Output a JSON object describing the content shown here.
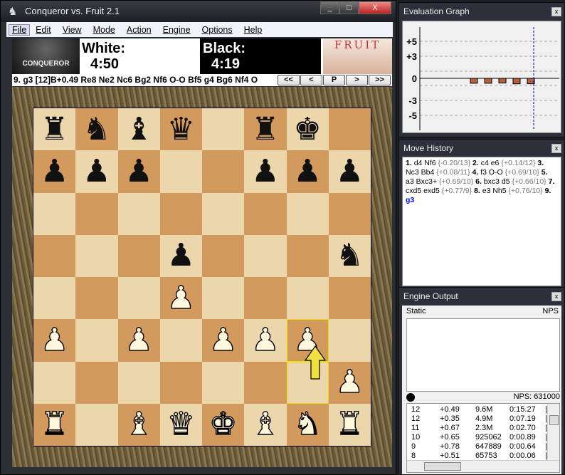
{
  "window": {
    "title": "Conqueror vs. Fruit 2.1",
    "min": "_",
    "max": "□",
    "close": "X"
  },
  "menu": [
    "File",
    "Edit",
    "View",
    "Mode",
    "Action",
    "Engine",
    "Options",
    "Help"
  ],
  "header": {
    "white_logo": "CONQUEROR",
    "white_label": "White:",
    "white_time": "4:50",
    "black_label": "Black:",
    "black_time": "4:19",
    "black_logo": "FRUIT"
  },
  "moveline": {
    "text": "9. g3  [12]B+0.49 Re8 Ne2 Nc6 Bg2 Nf6 O-O Bf5 g4 Bg6 Nf4 O",
    "buttons": [
      "<<",
      "<",
      "P",
      ">",
      ">>"
    ]
  },
  "board": {
    "rows": [
      [
        "br",
        "bn",
        "bb",
        "bq",
        "",
        "br",
        "bk",
        ""
      ],
      [
        "bp",
        "bp",
        "bp",
        "",
        "",
        "bp",
        "bp",
        "bp"
      ],
      [
        "",
        "",
        "",
        "",
        "",
        "",
        "",
        ""
      ],
      [
        "",
        "",
        "",
        "bp",
        "",
        "",
        "",
        "bn"
      ],
      [
        "",
        "",
        "",
        "wp",
        "",
        "",
        "",
        ""
      ],
      [
        "wp",
        "",
        "wp",
        "",
        "wp",
        "wp",
        "wp",
        ""
      ],
      [
        "",
        "",
        "",
        "",
        "",
        "",
        "",
        "wp"
      ],
      [
        "wr",
        "",
        "wb",
        "wq",
        "wk",
        "wb",
        "wn",
        "wr"
      ]
    ],
    "last_move": {
      "from": "g2",
      "to": "g3"
    },
    "highlight_color": "#e8e000"
  },
  "eval_graph": {
    "title": "Evaluation Graph",
    "close": "x",
    "labels": [
      "+5",
      "+3",
      "0",
      "-3",
      "-5"
    ],
    "gridlines": [
      5,
      3,
      1,
      -1,
      -3,
      -5
    ],
    "bars": [
      -0.69,
      -0.69,
      -0.66,
      -0.77,
      -0.76
    ],
    "bar_color": "#b5603f",
    "cursor_color": "#0000cc"
  },
  "move_history": {
    "title": "Move History",
    "close": "x",
    "moves": [
      {
        "n": "1.",
        "m": "d4 Nf6",
        "c": "{-0.20/13}"
      },
      {
        "n": "2.",
        "m": "c4 e6",
        "c": "{+0.14/12}"
      },
      {
        "n": "3.",
        "m": "Nc3 Bb4",
        "c": "{+0.08/11}"
      },
      {
        "n": "4.",
        "m": "f3 O-O",
        "c": "{+0.69/10}"
      },
      {
        "n": "5.",
        "m": "a3 Bxc3+",
        "c": "{+0.69/10}"
      },
      {
        "n": "6.",
        "m": "bxc3 d5",
        "c": "{+0.66/10}"
      },
      {
        "n": "7.",
        "m": "cxd5 exd5",
        "c": "{+0.77/9}"
      },
      {
        "n": "8.",
        "m": "e3 Nh5",
        "c": "{+0.76/10}"
      },
      {
        "n": "9.",
        "cur": "g3"
      }
    ]
  },
  "engine_output": {
    "title": "Engine Output",
    "close": "x",
    "static_label": "Static",
    "nps_label": "NPS",
    "nps_value": "NPS: 631000",
    "rows": [
      [
        "12",
        "+0.49",
        "9.6M",
        "0:15.27"
      ],
      [
        "12",
        "+0.35",
        "4.9M",
        "0:07.19"
      ],
      [
        "11",
        "+0.67",
        "2.3M",
        "0:02.70"
      ],
      [
        "10",
        "+0.65",
        "925062",
        "0:00.89"
      ],
      [
        "9",
        "+0.78",
        "647889",
        "0:00.64"
      ],
      [
        "8",
        "+0.51",
        "65753",
        "0:00.06"
      ]
    ]
  }
}
